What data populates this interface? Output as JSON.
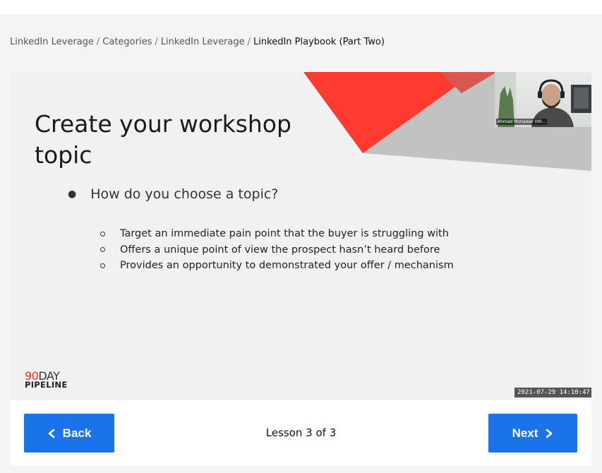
{
  "breadcrumb": {
    "items": [
      "LinkedIn Leverage",
      "Categories",
      "LinkedIn Leverage"
    ],
    "separator": "/",
    "current": "LinkedIn Playbook (Part Two)"
  },
  "slide": {
    "title": "Create your workshop topic",
    "bullet": "How do you choose a topic?",
    "sub_bullets": [
      "Target an immediate pain point that the buyer is struggling with",
      "Offers a unique point of view the prospect hasn’t heard before",
      "Provides an opportunity to demonstrated your offer / mechanism"
    ],
    "logo_top_number": "90",
    "logo_top_word": "DAY",
    "logo_bottom": "PIPELINE"
  },
  "webcam": {
    "label": "Ahmad Munawar (90..."
  },
  "video": {
    "timestamp": "2021-07-29 14:10:47"
  },
  "nav": {
    "back_label": "Back",
    "next_label": "Next",
    "lesson_text": "Lesson 3 of 3"
  },
  "colors": {
    "accent": "#1a73e8",
    "slide_red": "#ff3a2f",
    "slide_grey": "#b4b4b4",
    "logo_red": "#e2342b"
  },
  "icons": {
    "back": "chevron-left-icon",
    "next": "chevron-right-icon"
  }
}
